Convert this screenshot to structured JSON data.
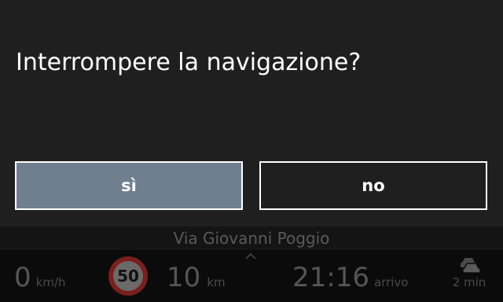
{
  "dialog": {
    "title": "Interrompere la navigazione?",
    "yes_label": "sì",
    "no_label": "no"
  },
  "navigation": {
    "street": "Via Giovanni Poggio",
    "current_speed": "0",
    "speed_unit": "km/h",
    "speed_limit": "50",
    "distance": "10",
    "distance_unit": "km",
    "arrival_time": "21:16",
    "arrival_label": "arrivo",
    "traffic_delay": "2 min",
    "icons": [
      "chevron-up-icon",
      "speed-limit-sign-icon",
      "traffic-cars-icon"
    ]
  },
  "colors": {
    "dialog_bg": "#1f1f1f",
    "yes_button_bg": "#6f7f8f",
    "button_border": "#ffffff",
    "speed_limit_ring": "#7b1e1e"
  }
}
